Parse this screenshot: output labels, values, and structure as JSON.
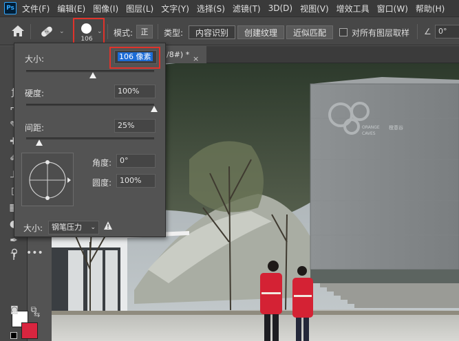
{
  "app": {
    "logo": "Ps"
  },
  "menu": [
    "文件(F)",
    "编辑(E)",
    "图像(I)",
    "图层(L)",
    "文字(Y)",
    "选择(S)",
    "滤镜(T)",
    "3D(D)",
    "视图(V)",
    "增效工具",
    "窗口(W)",
    "帮助(H)"
  ],
  "options": {
    "brush_size": "106",
    "mode_label": "模式:",
    "mode_value": "正",
    "type_label": "类型:",
    "type_buttons": [
      "内容识别",
      "创建纹理",
      "近似匹配"
    ],
    "sample_all_layers": "对所有图层取样",
    "angle_value": "0°"
  },
  "document_tab": {
    "title": "/8#) *",
    "close": "×"
  },
  "brush_panel": {
    "size_label": "大小:",
    "size_value_num": "106",
    "size_value_unit": "像素",
    "size_fraction": 0.52,
    "hardness_label": "硬度:",
    "hardness_value": "100%",
    "hardness_fraction": 1.0,
    "spacing_label": "间距:",
    "spacing_value": "25%",
    "spacing_fraction": 0.1,
    "angle_label": "角度:",
    "angle_value": "0°",
    "roundness_label": "圆度:",
    "roundness_value": "100%",
    "pressure_label": "大小:",
    "pressure_value": "钢笔压力"
  },
  "colors": {
    "foreground": "#ffffff",
    "background": "#d9253f",
    "highlight_frame": "#e0332b",
    "selection": "#1c6bd6"
  },
  "photo": {
    "sign_line1": "ORANGE",
    "sign_line2": "CAVES",
    "sign_cn": "橙意谷"
  }
}
